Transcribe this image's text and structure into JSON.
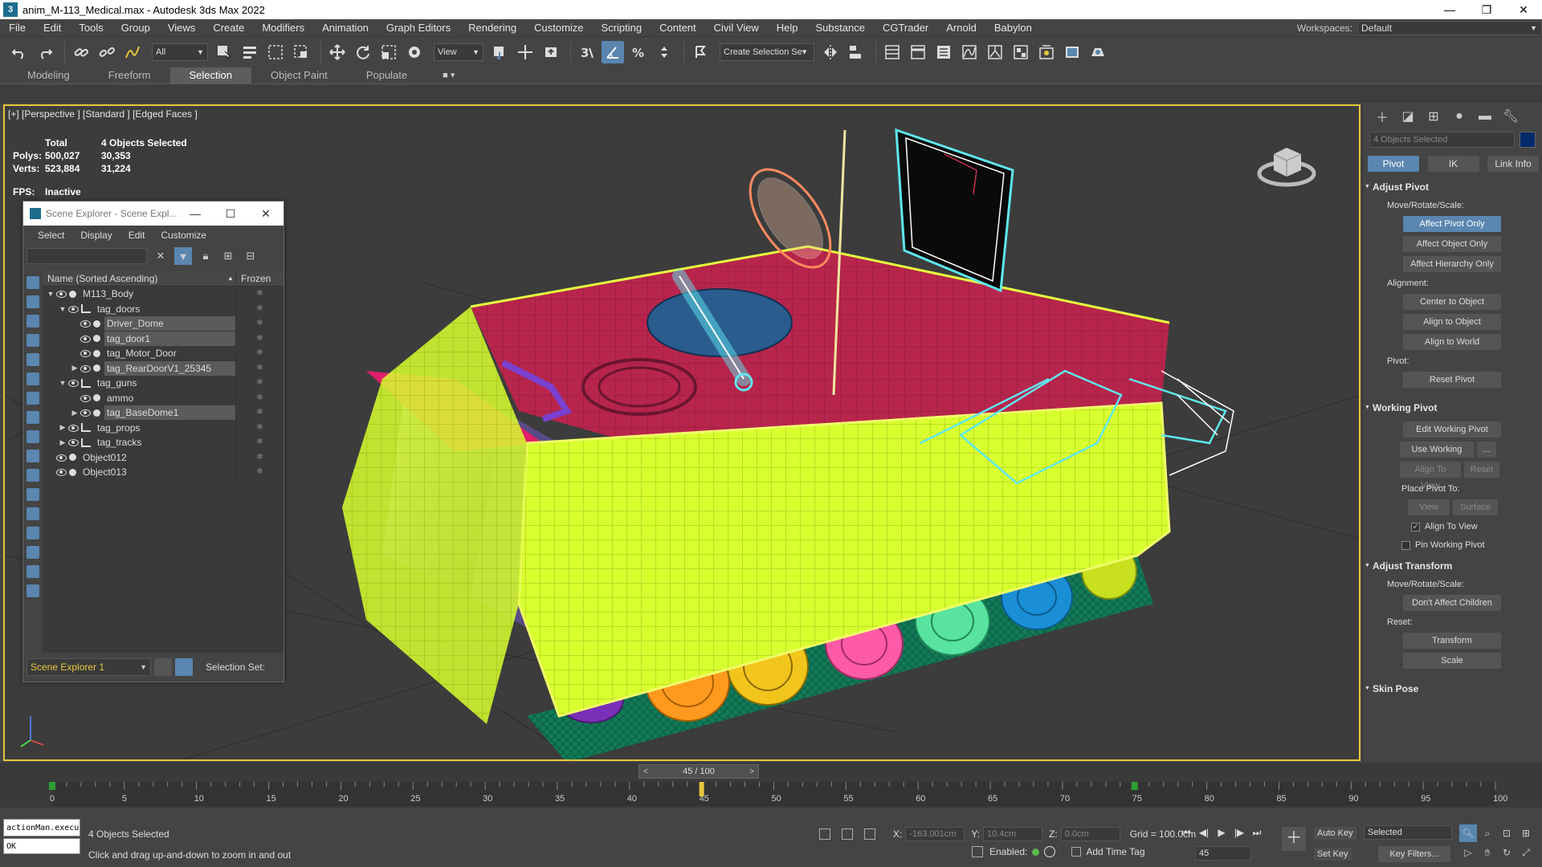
{
  "window": {
    "title": "anim_M-113_Medical.max - Autodesk 3ds Max 2022",
    "app_icon": "3",
    "btn_minimize": "—",
    "btn_restore": "❐",
    "btn_close": "✕"
  },
  "menu": {
    "items": [
      "File",
      "Edit",
      "Tools",
      "Group",
      "Views",
      "Create",
      "Modifiers",
      "Animation",
      "Graph Editors",
      "Rendering",
      "Customize",
      "Scripting",
      "Content",
      "Civil View",
      "Help",
      "Substance",
      "CGTrader",
      "Arnold",
      "Babylon"
    ],
    "workspace_label": "Workspaces:",
    "workspace_value": "Default"
  },
  "toolbar": {
    "filter_value": "All",
    "view_value": "View",
    "selection_set_value": "Create Selection Se▾",
    "icons": [
      "undo-icon",
      "redo-icon",
      "link-icon",
      "unlink-icon",
      "bind-space-warp-icon",
      "select-object-icon",
      "select-by-name-icon",
      "rect-region-icon",
      "window-crossing-icon",
      "move-icon",
      "rotate-icon",
      "scale-icon",
      "placement-icon",
      "snap-icon",
      "angle-snap-icon",
      "percent-snap-icon",
      "spinner-snap-icon",
      "mirror-icon",
      "align-icon",
      "layer-explorer-icon",
      "scene-explorer-icon",
      "curve-editor-icon",
      "schematic-view-icon",
      "material-editor-icon",
      "render-setup-icon",
      "rendered-frame-icon",
      "render-icon"
    ]
  },
  "ribbon": {
    "tabs": [
      "Modeling",
      "Freeform",
      "Selection",
      "Object Paint",
      "Populate"
    ],
    "active_tab": "Selection"
  },
  "viewport": {
    "label": "[+] [Perspective ] [Standard ] [Edged Faces ]",
    "stats": {
      "header_total": "Total",
      "header_selected": "4 Objects Selected",
      "polys_label": "Polys:",
      "polys_total": "500,027",
      "polys_selected": "30,353",
      "verts_label": "Verts:",
      "verts_total": "523,884",
      "verts_selected": "31,224",
      "fps_label": "FPS:",
      "fps_value": "Inactive"
    },
    "colors": {
      "border_active": "#e7c73e",
      "hull_yellow": "#d8ff2e",
      "hull_red": "#b8254c",
      "hull_pink": "#e0206a",
      "hull_purple": "#8a72c4",
      "wheel_orange": "#ff9a1e",
      "wheel_yellow": "#f2c51c",
      "wheel_pink": "#ff5aa7",
      "wheel_green": "#58e3a0",
      "wheel_blue": "#1a8fd6",
      "track_green": "#148a64",
      "wire_cyan": "#5ee8ee"
    }
  },
  "scene_explorer": {
    "title": "Scene Explorer - Scene Expl...",
    "menu": [
      "Select",
      "Display",
      "Edit",
      "Customize"
    ],
    "column_name": "Name (Sorted Ascending)",
    "column_frozen": "Frozen",
    "rows": [
      {
        "name": "M113_Body",
        "depth": 0,
        "arrow": "▼",
        "kind": "object",
        "selected": false
      },
      {
        "name": "tag_doors",
        "depth": 1,
        "arrow": "▼",
        "kind": "layer",
        "selected": false
      },
      {
        "name": "Driver_Dome",
        "depth": 2,
        "arrow": "",
        "kind": "object",
        "selected": true
      },
      {
        "name": "tag_door1",
        "depth": 2,
        "arrow": "",
        "kind": "object",
        "selected": true
      },
      {
        "name": "tag_Motor_Door",
        "depth": 2,
        "arrow": "",
        "kind": "object",
        "selected": false
      },
      {
        "name": "tag_RearDoorV1_25345",
        "depth": 2,
        "arrow": "▶",
        "kind": "object",
        "selected": true
      },
      {
        "name": "tag_guns",
        "depth": 1,
        "arrow": "▼",
        "kind": "layer",
        "selected": false
      },
      {
        "name": "ammo",
        "depth": 2,
        "arrow": "",
        "kind": "object",
        "selected": false
      },
      {
        "name": "tag_BaseDome1",
        "depth": 2,
        "arrow": "▶",
        "kind": "object",
        "selected": true
      },
      {
        "name": "tag_props",
        "depth": 1,
        "arrow": "▶",
        "kind": "layer",
        "selected": false
      },
      {
        "name": "tag_tracks",
        "depth": 1,
        "arrow": "▶",
        "kind": "layer",
        "selected": false
      },
      {
        "name": "Object012",
        "depth": 0,
        "arrow": "",
        "kind": "object",
        "selected": false
      },
      {
        "name": "Object013",
        "depth": 0,
        "arrow": "",
        "kind": "object",
        "selected": false
      }
    ],
    "explorer_name": "Scene Explorer 1",
    "selection_set_label": "Selection Set:"
  },
  "command_panel": {
    "object_name": "4 Objects Selected",
    "hier_tabs": [
      "Pivot",
      "IK",
      "Link Info"
    ],
    "adjust_pivot": {
      "title": "Adjust Pivot",
      "move_label": "Move/Rotate/Scale:",
      "btn_affect_pivot": "Affect Pivot Only",
      "btn_affect_object": "Affect Object Only",
      "btn_affect_hierarchy": "Affect Hierarchy Only",
      "alignment_label": "Alignment:",
      "btn_center": "Center to Object",
      "btn_align_object": "Align to Object",
      "btn_align_world": "Align to World",
      "pivot_label": "Pivot:",
      "btn_reset_pivot": "Reset Pivot"
    },
    "working_pivot": {
      "title": "Working Pivot",
      "btn_edit": "Edit Working Pivot",
      "btn_use": "Use Working Pivot",
      "btn_use_more": "...",
      "btn_align_view": "Align To View",
      "btn_reset": "Reset",
      "place_label": "Place Pivot To:",
      "btn_view": "View",
      "btn_surface": "Surface",
      "chk_align_view": "Align To View",
      "chk_align_view_mark": "✓",
      "chk_pin": "Pin Working Pivot"
    },
    "adjust_transform": {
      "title": "Adjust Transform",
      "move_label": "Move/Rotate/Scale:",
      "btn_dont_affect": "Don't Affect Children",
      "reset_label": "Reset:",
      "btn_transform": "Transform",
      "btn_scale": "Scale"
    },
    "skin_pose": {
      "title": "Skin Pose"
    }
  },
  "timeline": {
    "frame_display": "45 / 100",
    "current_frame": 45,
    "max_frame": 100,
    "tick_labels": [
      "0",
      "5",
      "10",
      "15",
      "20",
      "25",
      "30",
      "35",
      "40",
      "45",
      "50",
      "55",
      "60",
      "65",
      "70",
      "75",
      "80",
      "85",
      "90",
      "95",
      "100"
    ],
    "key_frames": [
      0,
      75
    ]
  },
  "status": {
    "maxscript_line1": "actionMan.execu",
    "maxscript_line2": "OK",
    "selection_text": "4 Objects Selected",
    "prompt_text": "Click and drag up-and-down to zoom in and out",
    "x_label": "X:",
    "x_value": "-163.001cm",
    "y_label": "Y:",
    "y_value": "10.4cm",
    "z_label": "Z:",
    "z_value": "0.0cm",
    "grid_text": "Grid = 100.0cm",
    "enabled_label": "Enabled:",
    "add_time_tag": "Add Time Tag",
    "frame_value": "45",
    "auto_key": "Auto Key",
    "set_key": "Set Key",
    "selected_dd": "Selected",
    "key_filters": "Key Filters..."
  }
}
